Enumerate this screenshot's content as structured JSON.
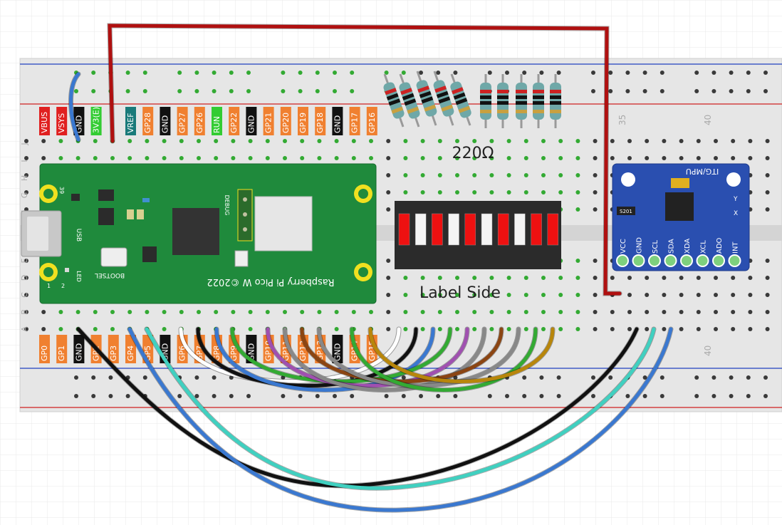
{
  "resistor_label": "220Ω",
  "bargraph_label": "Label Side",
  "column_numbers": [
    "35",
    "40"
  ],
  "row_letters_top": [
    "J",
    "I",
    "H",
    "G",
    "F"
  ],
  "row_letters_bottom": [
    "E",
    "D",
    "C",
    "B",
    "A"
  ],
  "top_pin_labels": [
    {
      "text": "VBUS",
      "color": "#e02020"
    },
    {
      "text": "VSYS",
      "color": "#e02020"
    },
    {
      "text": "GND",
      "color": "#111111"
    },
    {
      "text": "3V3(E)",
      "color": "#33cc33"
    },
    {
      "text": "",
      "color": ""
    },
    {
      "text": "VREF",
      "color": "#1a7a7a"
    },
    {
      "text": "GP28",
      "color": "#f08030"
    },
    {
      "text": "GND",
      "color": "#111111"
    },
    {
      "text": "GP27",
      "color": "#f08030"
    },
    {
      "text": "GP26",
      "color": "#f08030"
    },
    {
      "text": "RUN",
      "color": "#33cc33"
    },
    {
      "text": "GP22",
      "color": "#f08030"
    },
    {
      "text": "GND",
      "color": "#111111"
    },
    {
      "text": "GP21",
      "color": "#f08030"
    },
    {
      "text": "GP20",
      "color": "#f08030"
    },
    {
      "text": "GP19",
      "color": "#f08030"
    },
    {
      "text": "GP18",
      "color": "#f08030"
    },
    {
      "text": "GND",
      "color": "#111111"
    },
    {
      "text": "GP17",
      "color": "#f08030"
    },
    {
      "text": "GP16",
      "color": "#f08030"
    }
  ],
  "bottom_pin_labels": [
    {
      "text": "GP0",
      "color": "#f08030"
    },
    {
      "text": "GP1",
      "color": "#f08030"
    },
    {
      "text": "GND",
      "color": "#111111"
    },
    {
      "text": "GP2",
      "color": "#f08030"
    },
    {
      "text": "GP3",
      "color": "#f08030"
    },
    {
      "text": "GP4",
      "color": "#f08030"
    },
    {
      "text": "GP5",
      "color": "#f08030"
    },
    {
      "text": "GND",
      "color": "#111111"
    },
    {
      "text": "GP6",
      "color": "#f08030"
    },
    {
      "text": "GP7",
      "color": "#f08030"
    },
    {
      "text": "GP8",
      "color": "#f08030"
    },
    {
      "text": "GP9",
      "color": "#f08030"
    },
    {
      "text": "GND",
      "color": "#111111"
    },
    {
      "text": "GP10",
      "color": "#f08030"
    },
    {
      "text": "GP11",
      "color": "#f08030"
    },
    {
      "text": "GP12",
      "color": "#f08030"
    },
    {
      "text": "GP13",
      "color": "#f08030"
    },
    {
      "text": "GND",
      "color": "#111111"
    },
    {
      "text": "GP14",
      "color": "#f08030"
    },
    {
      "text": "GP15",
      "color": "#f08030"
    }
  ],
  "pico": {
    "board_name": "Raspberry Pi Pico W ©2022",
    "bootsel": "BOOTSEL",
    "usb": "USB",
    "led": "LED",
    "debug": "DEBUG",
    "pin1": "1",
    "pin2": "2",
    "pin39": "39"
  },
  "mpu": {
    "name": "ITG/MPU",
    "chip": "S201",
    "pins": [
      "VCC",
      "GND",
      "SCL",
      "SDA",
      "XDA",
      "XCL",
      "ADO",
      "INT"
    ],
    "axis_y": "Y",
    "axis_x": "X"
  },
  "bargraph_segments": [
    "red",
    "white",
    "red",
    "white",
    "red",
    "white",
    "red",
    "white",
    "red",
    "red"
  ],
  "colors": {
    "breadboard": "#e6e6e6",
    "hole": "#3a3a3a",
    "used_hole": "#33aa33",
    "pico_green": "#1f8a3c",
    "mpu_blue": "#2a4fb0",
    "rail_red": "#d02020",
    "rail_blue": "#2040c0",
    "wire_red": "#b01010"
  }
}
